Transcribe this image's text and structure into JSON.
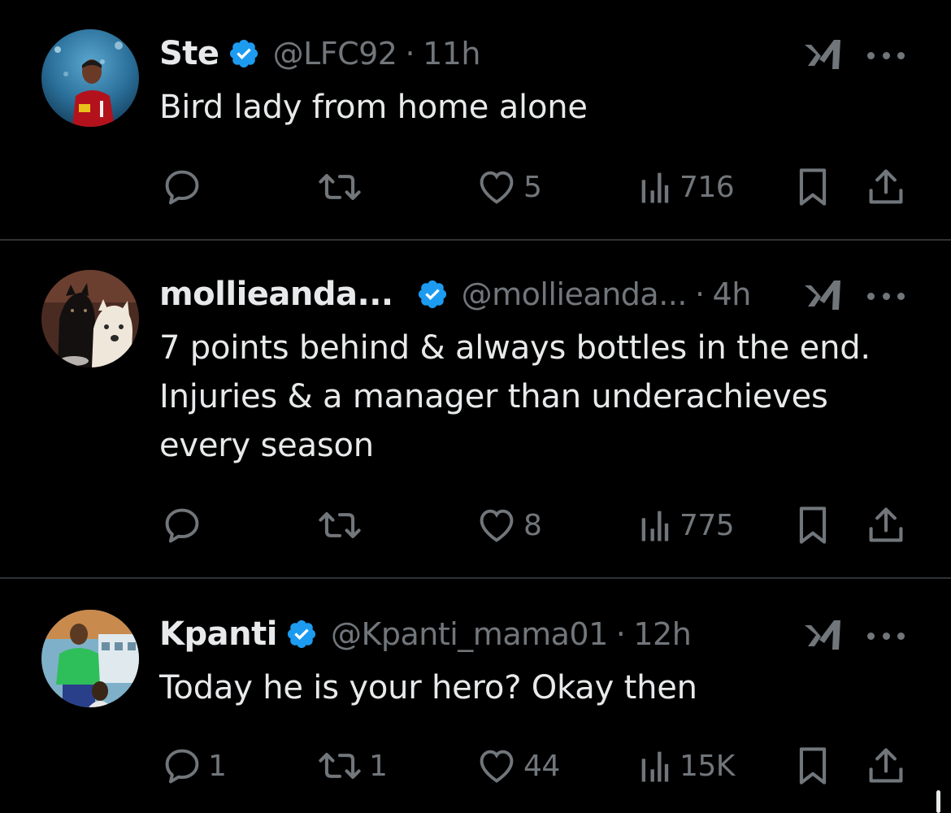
{
  "colors": {
    "background": "#000000",
    "text_primary": "#e7e9ea",
    "text_secondary": "#71767b",
    "verified_blue": "#1d9bf0",
    "divider": "#2f3336"
  },
  "tweets": [
    {
      "name": "Ste",
      "handle": "@LFC92",
      "separator": "·",
      "time": "11h",
      "text_lines": [
        "Bird lady from home alone"
      ],
      "stats": {
        "replies": "",
        "reposts": "",
        "likes": "5",
        "views": "716"
      },
      "avatar_icon": "avatar-footballer-icon"
    },
    {
      "name": "mollieanda...",
      "handle": "@mollieanda...",
      "separator": "·",
      "time": "4h",
      "text_lines": [
        "7 points behind & always bottles in the end.",
        "Injuries & a manager than underachieves",
        "every season"
      ],
      "stats": {
        "replies": "",
        "reposts": "",
        "likes": "8",
        "views": "775"
      },
      "avatar_icon": "avatar-dogs-icon"
    },
    {
      "name": "Kpanti",
      "handle": "@Kpanti_mama01",
      "separator": "·",
      "time": "12h",
      "text_lines": [
        "Today he is your hero? Okay then"
      ],
      "stats": {
        "replies": "1",
        "reposts": "1",
        "likes": "44",
        "views": "15K"
      },
      "avatar_icon": "avatar-person-icon"
    }
  ]
}
